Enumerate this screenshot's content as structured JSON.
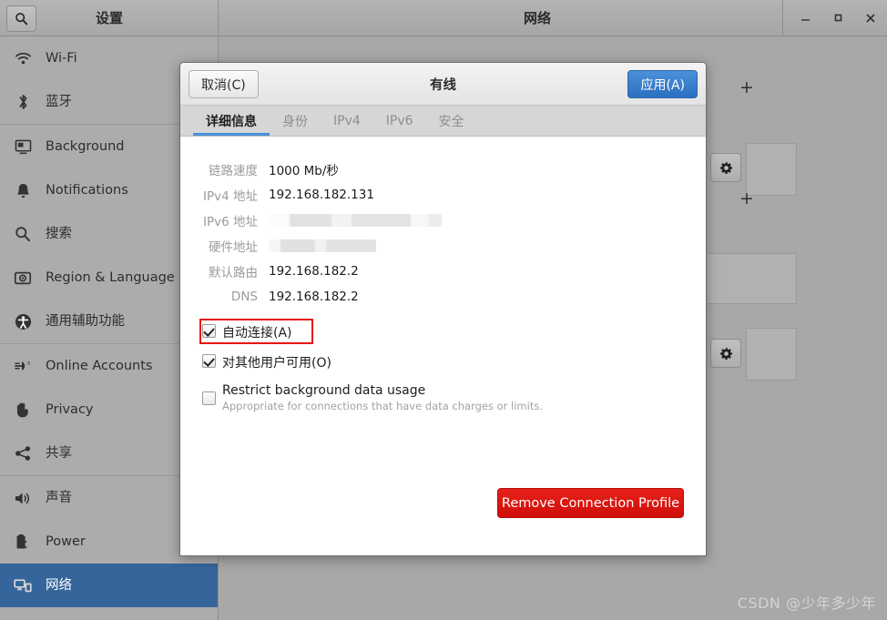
{
  "window": {
    "settings_title": "设置",
    "page_title": "网络",
    "controls": {
      "minimize": "–",
      "maximize": "□",
      "close": "✕"
    },
    "search_icon": "search-icon"
  },
  "sidebar": {
    "items": [
      {
        "label": "Wi-Fi",
        "icon": "wifi-icon",
        "selected": false
      },
      {
        "label": "蓝牙",
        "icon": "bluetooth-icon",
        "selected": false
      },
      {
        "label": "Background",
        "icon": "background-icon",
        "selected": false
      },
      {
        "label": "Notifications",
        "icon": "bell-icon",
        "selected": false
      },
      {
        "label": "搜索",
        "icon": "search-icon",
        "selected": false
      },
      {
        "label": "Region & Language",
        "icon": "globe-icon",
        "selected": false
      },
      {
        "label": "通用辅助功能",
        "icon": "accessibility-icon",
        "selected": false
      },
      {
        "label": "Online Accounts",
        "icon": "online-accounts-icon",
        "selected": false
      },
      {
        "label": "Privacy",
        "icon": "hand-icon",
        "selected": false
      },
      {
        "label": "共享",
        "icon": "share-icon",
        "selected": false
      },
      {
        "label": "声音",
        "icon": "speaker-icon",
        "selected": false
      },
      {
        "label": "Power",
        "icon": "battery-icon",
        "selected": false
      },
      {
        "label": "网络",
        "icon": "network-icon",
        "selected": true
      }
    ],
    "separator_after": [
      1,
      6,
      9
    ]
  },
  "background_panel": {
    "add_button_label": "+",
    "gear_icon": "gear-icon"
  },
  "dialog": {
    "title": "有线",
    "cancel_label": "取消(C)",
    "apply_label": "应用(A)",
    "tabs": [
      {
        "label": "详细信息",
        "active": true
      },
      {
        "label": "身份",
        "active": false
      },
      {
        "label": "IPv4",
        "active": false
      },
      {
        "label": "IPv6",
        "active": false
      },
      {
        "label": "安全",
        "active": false
      }
    ],
    "details": [
      {
        "key": "链路速度",
        "value": "1000 Mb/秒",
        "redacted": false
      },
      {
        "key": "IPv4 地址",
        "value": "192.168.182.131",
        "redacted": false
      },
      {
        "key": "IPv6 地址",
        "value": "",
        "redacted": "wide"
      },
      {
        "key": "硬件地址",
        "value": "",
        "redacted": "narrow"
      },
      {
        "key": "默认路由",
        "value": "192.168.182.2",
        "redacted": false
      },
      {
        "key": "DNS",
        "value": "192.168.182.2",
        "redacted": false
      }
    ],
    "checkboxes": [
      {
        "label": "自动连接(A)",
        "sub": "",
        "checked": true,
        "highlighted": true
      },
      {
        "label": "对其他用户可用(O)",
        "sub": "",
        "checked": true,
        "highlighted": false
      },
      {
        "label": "Restrict background data usage",
        "sub": "Appropriate for connections that have data charges or limits.",
        "checked": false,
        "highlighted": false
      }
    ],
    "remove_button_label": "Remove Connection Profile"
  },
  "watermark": "CSDN @少年多少年",
  "colors": {
    "accent_blue": "#4a90d9",
    "selected_blue": "#35659b",
    "danger_red": "#d6120c",
    "highlight_red": "#e8150f",
    "window_gray": "#a8a8a8"
  }
}
